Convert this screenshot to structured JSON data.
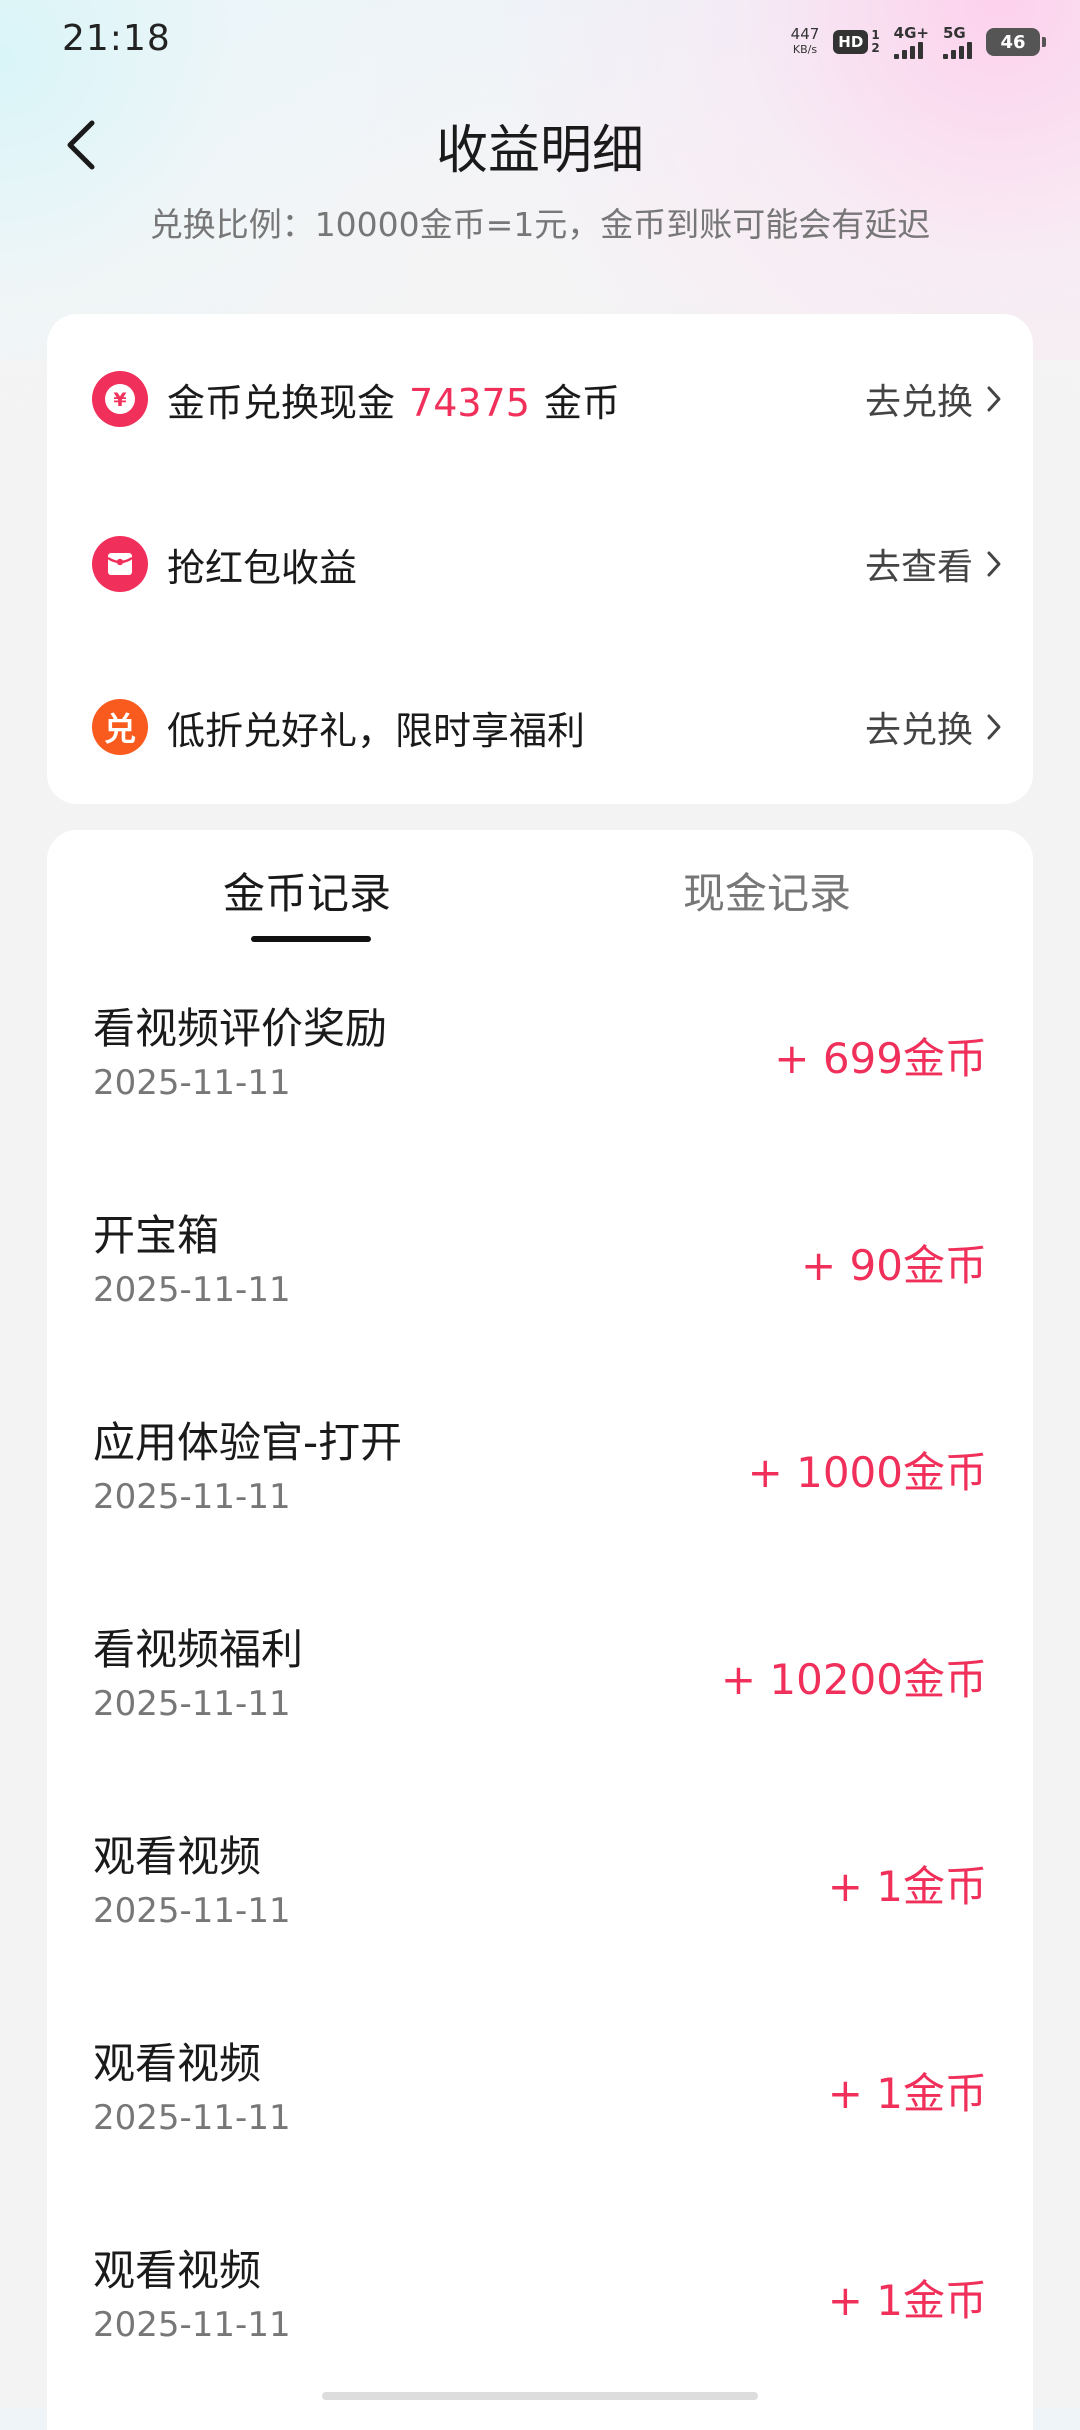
{
  "status_bar": {
    "time": "21:18",
    "net_speed": "447",
    "net_unit": "KB/s",
    "hd_label": "HD",
    "hd_sub_top": "1",
    "hd_sub_bottom": "2",
    "sim1_tech": "4G+",
    "sim2_tech": "5G",
    "battery": "46"
  },
  "header": {
    "title": "收益明细",
    "exchange_note": "兑换比例：10000金币=1元，金币到账可能会有延迟"
  },
  "menu": {
    "items": [
      {
        "icon": "yen-icon",
        "label": "金币兑换现金",
        "amount": "74375",
        "unit": "金币",
        "action": "去兑换",
        "color": "#f0305a"
      },
      {
        "icon": "red-packet-icon",
        "label": "抢红包收益",
        "action": "去查看",
        "color": "#f0305a"
      },
      {
        "icon": "exchange-char-icon",
        "icon_text": "兑",
        "label": "低折兑好礼，限时享福利",
        "action": "去兑换",
        "color": "#f95a1e"
      }
    ]
  },
  "tabs": {
    "coin": "金币记录",
    "cash": "现金记录",
    "active": "coin"
  },
  "records": [
    {
      "title": "看视频评价奖励",
      "date": "2025-11-11",
      "amount": "+ 699金币"
    },
    {
      "title": "开宝箱",
      "date": "2025-11-11",
      "amount": "+ 90金币"
    },
    {
      "title": "应用体验官-打开",
      "date": "2025-11-11",
      "amount": "+ 1000金币"
    },
    {
      "title": "看视频福利",
      "date": "2025-11-11",
      "amount": "+ 10200金币"
    },
    {
      "title": "观看视频",
      "date": "2025-11-11",
      "amount": "+ 1金币"
    },
    {
      "title": "观看视频",
      "date": "2025-11-11",
      "amount": "+ 1金币"
    },
    {
      "title": "观看视频",
      "date": "2025-11-11",
      "amount": "+ 1金币"
    }
  ],
  "colors": {
    "accent": "#f0305a",
    "orange": "#f95a1e"
  }
}
